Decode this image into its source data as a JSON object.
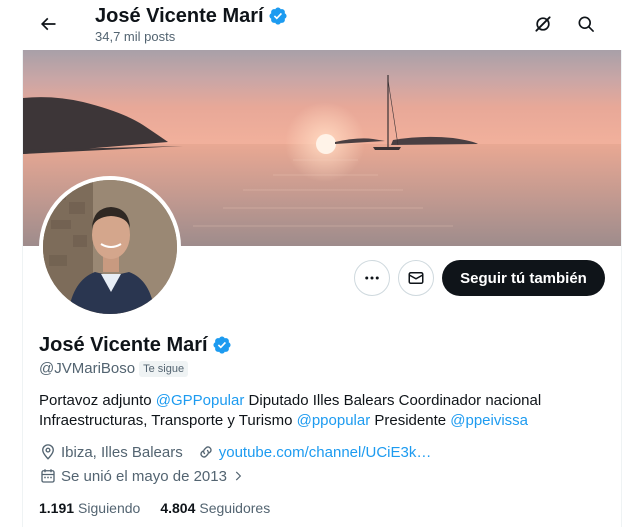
{
  "header": {
    "name": "José Vicente Marí",
    "posts_count": "34,7 mil posts"
  },
  "profile": {
    "name": "José Vicente Marí",
    "handle": "@JVMariBoso",
    "follows_you_badge": "Te sigue",
    "bio": {
      "p1": "Portavoz adjunto ",
      "mention1": "@GPPopular",
      "p2": " Diputado Illes Balears Coordinador nacional Infraestructuras, Transporte y Turismo ",
      "mention2": "@ppopular",
      "p3": " Presidente ",
      "mention3": "@ppeivissa"
    },
    "location": "Ibiza, Illes Balears",
    "website": "youtube.com/channel/UCiE3k…",
    "joined": "Se unió el mayo de 2013",
    "following_count": "1.191",
    "following_label": "Siguiendo",
    "followers_count": "4.804",
    "followers_label": "Seguidores"
  },
  "actions": {
    "follow_label": "Seguir tú también"
  },
  "icons": {
    "back": "arrow-left-icon",
    "grok": "grok-icon",
    "search": "search-icon",
    "more": "more-icon",
    "message": "envelope-icon",
    "verified": "verified-badge-icon",
    "location": "location-pin-icon",
    "link": "link-icon",
    "calendar": "calendar-icon"
  },
  "colors": {
    "accent": "#1d9bf0",
    "text": "#0f1419",
    "muted": "#536471",
    "button_dark": "#0f1419"
  }
}
